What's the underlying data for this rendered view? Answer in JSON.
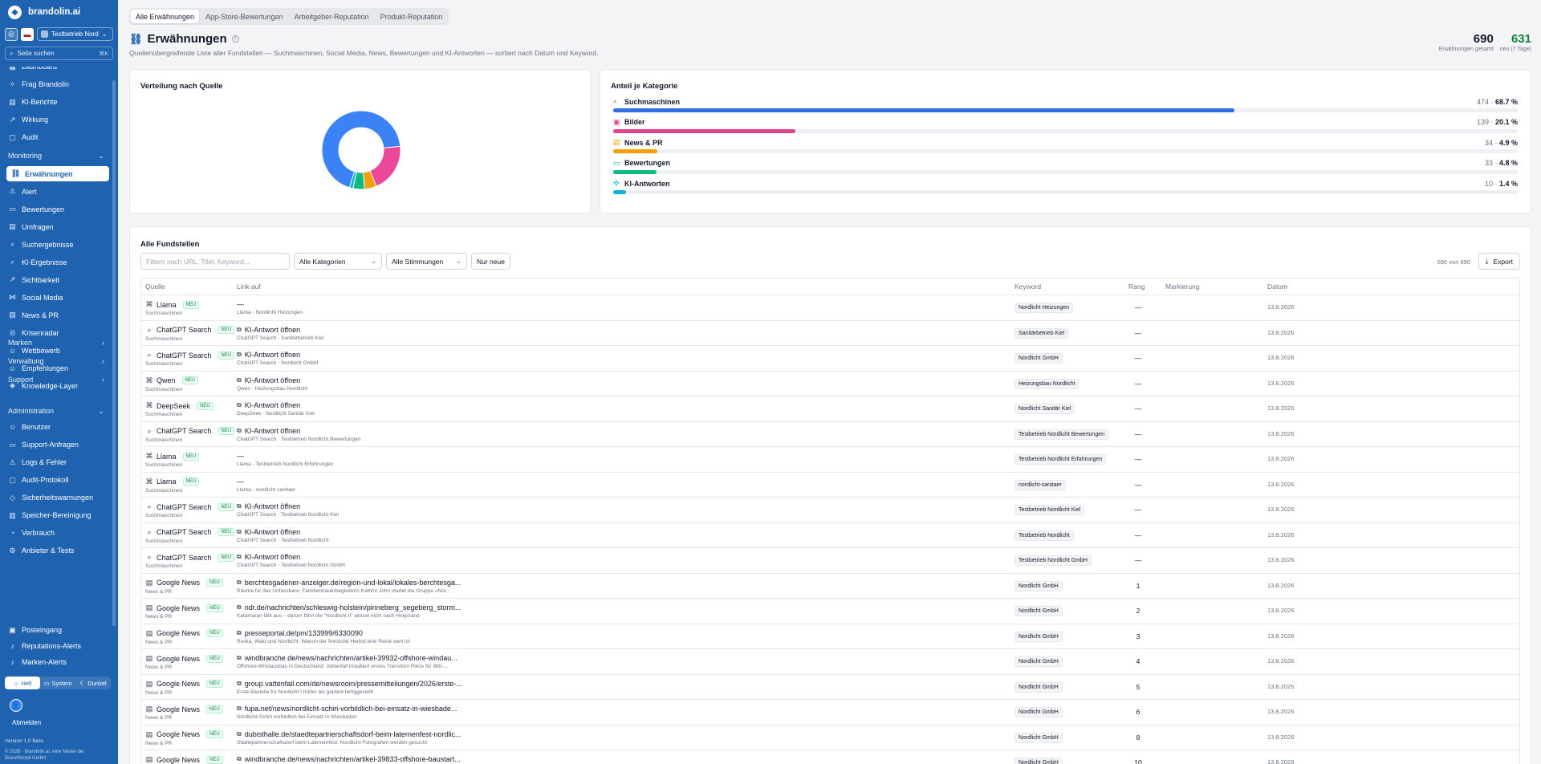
{
  "brand": "brandolin.ai",
  "tenant": "Testbetrieb Nord",
  "sidebar_search": {
    "placeholder": "Seite suchen",
    "shortcut": "⌘K"
  },
  "nav_top": [
    {
      "label": "Dashboard",
      "icon": "grid-icon",
      "y": -9
    },
    {
      "label": "Frag Brandolin",
      "icon": "sparkle-icon",
      "y": 13
    },
    {
      "label": "KI-Berichte",
      "icon": "file-icon",
      "y": 35
    },
    {
      "label": "Wirkung",
      "icon": "trend-icon",
      "y": 57
    },
    {
      "label": "Audit",
      "icon": "doc-icon",
      "y": 79
    }
  ],
  "monitoring_label": "Monitoring",
  "monitoring_items": [
    {
      "label": "Erwähnungen",
      "icon": "link-icon",
      "active": true
    },
    {
      "label": "Alert",
      "icon": "alert-icon"
    },
    {
      "label": "Bewertungen",
      "icon": "chat-icon"
    },
    {
      "label": "Umfragen",
      "icon": "clipboard-icon"
    },
    {
      "label": "Suchergebnisse",
      "icon": "search-icon"
    },
    {
      "label": "KI-Ergebnisse",
      "icon": "search-icon"
    },
    {
      "label": "Sichtbarkeit",
      "icon": "trend-icon"
    },
    {
      "label": "Social Media",
      "icon": "share-icon"
    },
    {
      "label": "News & PR",
      "icon": "news-icon"
    },
    {
      "label": "Krisenradar",
      "icon": "radar-icon"
    },
    {
      "label": "Wettbewerb",
      "icon": "people-icon"
    },
    {
      "label": "Empfehlungen",
      "icon": "people-icon"
    },
    {
      "label": "Knowledge-Layer",
      "icon": "layers-icon"
    }
  ],
  "sections": [
    {
      "label": "Marken",
      "chev": "›"
    },
    {
      "label": "Verwaltung",
      "chev": "›"
    },
    {
      "label": "Support",
      "chev": "›"
    }
  ],
  "admin_label": "Administration",
  "admin_items": [
    {
      "label": "Benutzer",
      "icon": "people-icon"
    },
    {
      "label": "Support-Anfragen",
      "icon": "chat-icon"
    },
    {
      "label": "Logs & Fehler",
      "icon": "alert-icon"
    },
    {
      "label": "Audit-Protokoll",
      "icon": "doc-icon"
    },
    {
      "label": "Sicherheitswarnungen",
      "icon": "shield-icon"
    },
    {
      "label": "Speicher-Bereinigung",
      "icon": "trash-icon"
    },
    {
      "label": "Verbrauch",
      "icon": "gauge-icon"
    },
    {
      "label": "Anbieter & Tests",
      "icon": "gear-icon"
    }
  ],
  "extra_items": [
    {
      "label": "Posteingang",
      "icon": "inbox-icon"
    },
    {
      "label": "Reputations-Alerts",
      "icon": "bell-icon"
    },
    {
      "label": "Marken-Alerts",
      "icon": "bell-icon"
    }
  ],
  "theme": {
    "light": "Hell",
    "system": "System",
    "dark": "Dunkel"
  },
  "logout": "Abmelden",
  "version": "Version 1.0 Beta",
  "copyright": "© 2026 · brandolin.ai, eine Marke der BrandSimpli GmbH",
  "tabs": [
    "Alle Erwähnungen",
    "App-Store-Bewertungen",
    "Arbeitgeber-Reputation",
    "Produkt-Reputation"
  ],
  "page": {
    "title": "Erwähnungen",
    "subtitle": "Quellenübergreifende Liste aller Fundstellen — Suchmaschinen, Social Media, News, Bewertungen und KI-Antworten — sortiert nach Datum und Keyword."
  },
  "stats": [
    {
      "value": "690",
      "label": "Erwähnungen gesamt",
      "green": false
    },
    {
      "value": "631",
      "label": "neu (7 Tage)",
      "green": true
    }
  ],
  "distribution_title": "Verteilung nach Quelle",
  "chart_data": {
    "type": "pie",
    "title": "Verteilung nach Quelle",
    "categories": [
      "Suchmaschinen",
      "Bilder",
      "News & PR",
      "Bewertungen",
      "KI-Antworten"
    ],
    "values": [
      474,
      139,
      34,
      33,
      10
    ],
    "colors": [
      "#3b82f6",
      "#ec4899",
      "#f59e0b",
      "#10b981",
      "#06b6d4"
    ]
  },
  "category_title": "Anteil je Kategorie",
  "categories": [
    {
      "label": "Suchmaschinen",
      "icon": "search-icon",
      "glyph": "⌕",
      "count": "474",
      "pct": "68.7 %",
      "fraction": 0.687,
      "color": "#2f6fe6"
    },
    {
      "label": "Bilder",
      "icon": "image-icon",
      "glyph": "▣",
      "count": "139",
      "pct": "20.1 %",
      "fraction": 0.201,
      "color": "#e0448c"
    },
    {
      "label": "News & PR",
      "icon": "news-icon",
      "glyph": "▤",
      "count": "34",
      "pct": "4.9 %",
      "fraction": 0.049,
      "color": "#f59e0b"
    },
    {
      "label": "Bewertungen",
      "icon": "chat-icon",
      "glyph": "▭",
      "count": "33",
      "pct": "4.8 %",
      "fraction": 0.048,
      "color": "#10b981"
    },
    {
      "label": "KI-Antworten",
      "icon": "sparkle-icon",
      "glyph": "✣",
      "count": "10",
      "pct": "1.4 %",
      "fraction": 0.014,
      "color": "#06b6d4"
    }
  ],
  "table_title": "Alle Fundstellen",
  "filter": {
    "placeholder": "Filtern nach URL, Titel, Keyword...",
    "categories": "Alle Kategorien",
    "moods": "Alle Stimmungen",
    "new_only": "Nur neue"
  },
  "count": "690 von 690",
  "export": "Export",
  "columns": {
    "source": "Quelle",
    "link": "Link auf",
    "keyword": "Keyword",
    "rank": "Rang",
    "mark": "Markierung",
    "date": "Datum"
  },
  "rows": [
    {
      "source": "Llama",
      "icon": "⌘",
      "type": "Suchmaschinen",
      "link": "—",
      "linkicon": "",
      "sub": "Llama · Nordlicht Heizungen",
      "keyword": "Nordlicht Heizungen",
      "rank": "—",
      "date": "13.8.2026"
    },
    {
      "source": "ChatGPT Search",
      "icon": "⌕",
      "type": "Suchmaschinen",
      "link": "KI-Antwort öffnen",
      "linkicon": "↗",
      "sub": "ChatGPT Search · Sanitärbetrieb Kiel",
      "keyword": "Sanitärbetrieb Kiel",
      "rank": "—",
      "date": "13.8.2026"
    },
    {
      "source": "ChatGPT Search",
      "icon": "⌕",
      "type": "Suchmaschinen",
      "link": "KI-Antwort öffnen",
      "linkicon": "↗",
      "sub": "ChatGPT Search · Nordlicht GmbH",
      "keyword": "Nordlicht GmbH",
      "rank": "—",
      "date": "13.8.2026"
    },
    {
      "source": "Qwen",
      "icon": "⌘",
      "type": "Suchmaschinen",
      "link": "KI-Antwort öffnen",
      "linkicon": "↗",
      "sub": "Qwen · Heizungsbau Nordlicht",
      "keyword": "Heizungsbau Nordlicht",
      "rank": "—",
      "date": "13.8.2026"
    },
    {
      "source": "DeepSeek",
      "icon": "⌘",
      "type": "Suchmaschinen",
      "link": "KI-Antwort öffnen",
      "linkicon": "↗",
      "sub": "DeepSeek · Nordlicht Sanitär Kiel",
      "keyword": "Nordlicht Sanitär Kiel",
      "rank": "—",
      "date": "13.8.2026"
    },
    {
      "source": "ChatGPT Search",
      "icon": "⌕",
      "type": "Suchmaschinen",
      "link": "KI-Antwort öffnen",
      "linkicon": "↗",
      "sub": "ChatGPT Search · Testbetrieb Nordlicht Bewertungen",
      "keyword": "Testbetrieb Nordlicht Bewertungen",
      "rank": "—",
      "date": "13.8.2026"
    },
    {
      "source": "Llama",
      "icon": "⌘",
      "type": "Suchmaschinen",
      "link": "—",
      "linkicon": "",
      "sub": "Llama · Testbetrieb Nordlicht Erfahrungen",
      "keyword": "Testbetrieb Nordlicht Erfahrungen",
      "rank": "—",
      "date": "13.8.2026"
    },
    {
      "source": "Llama",
      "icon": "⌘",
      "type": "Suchmaschinen",
      "link": "—",
      "linkicon": "",
      "sub": "Llama · nordlicht-sanitaer",
      "keyword": "nordlicht-sanitaer",
      "rank": "—",
      "date": "13.8.2026"
    },
    {
      "source": "ChatGPT Search",
      "icon": "⌕",
      "type": "Suchmaschinen",
      "link": "KI-Antwort öffnen",
      "linkicon": "↗",
      "sub": "ChatGPT Search · Testbetrieb Nordlicht Kiel",
      "keyword": "Testbetrieb Nordlicht Kiel",
      "rank": "—",
      "date": "13.8.2026"
    },
    {
      "source": "ChatGPT Search",
      "icon": "⌕",
      "type": "Suchmaschinen",
      "link": "KI-Antwort öffnen",
      "linkicon": "↗",
      "sub": "ChatGPT Search · Testbetrieb Nordlicht",
      "keyword": "Testbetrieb Nordlicht",
      "rank": "—",
      "date": "13.8.2026"
    },
    {
      "source": "ChatGPT Search",
      "icon": "⌕",
      "type": "Suchmaschinen",
      "link": "KI-Antwort öffnen",
      "linkicon": "↗",
      "sub": "ChatGPT Search · Testbetrieb Nordlicht GmbH",
      "keyword": "Testbetrieb Nordlicht GmbH",
      "rank": "—",
      "date": "13.8.2026"
    },
    {
      "source": "Google News",
      "icon": "▤",
      "type": "News & PR",
      "link": "berchtesgadener-anzeiger.de/region-und-lokal/lokales-berchtesga...",
      "linkicon": "↗",
      "sub": "Räume für das Unfassbare: Familientrauerbegleiterin Kathrin John startet die Gruppe »Nor...",
      "keyword": "Nordlicht GmbH",
      "rank": "1",
      "date": "13.8.2026"
    },
    {
      "source": "Google News",
      "icon": "▤",
      "type": "News & PR",
      "link": "ndr.de/nachrichten/schleswig-holstein/pinneberg_segeberg_storm...",
      "linkicon": "↗",
      "sub": "Katamaran fällt aus – darum fährt die \"Nordlicht II\" aktuell nicht nach Helgoland",
      "keyword": "Nordlicht GmbH",
      "rank": "2",
      "date": "13.8.2026"
    },
    {
      "source": "Google News",
      "icon": "▤",
      "type": "News & PR",
      "link": "presseportal.de/pm/133999/6330090",
      "linkicon": "↗",
      "sub": "Ruska, Wald und Nordlicht: Warum der finnische Herbst eine Reise wert ist",
      "keyword": "Nordlicht GmbH",
      "rank": "3",
      "date": "13.8.2026"
    },
    {
      "source": "Google News",
      "icon": "▤",
      "type": "News & PR",
      "link": "windbranche.de/news/nachrichten/artikel-39932-offshore-windau...",
      "linkicon": "↗",
      "sub": "Offshore-Windausbau in Deutschland: Vattenfall installiert erstes Transition Piece für 980-...",
      "keyword": "Nordlicht GmbH",
      "rank": "4",
      "date": "13.8.2026"
    },
    {
      "source": "Google News",
      "icon": "▤",
      "type": "News & PR",
      "link": "group.vattenfall.com/de/newsroom/pressemitteilungen/2026/erste-...",
      "linkicon": "↗",
      "sub": "Erste Bauteile für Nordlicht I früher als geplant fertiggestellt",
      "keyword": "Nordlicht GmbH",
      "rank": "5",
      "date": "13.8.2026"
    },
    {
      "source": "Google News",
      "icon": "▤",
      "type": "News & PR",
      "link": "fupa.net/news/nordlicht-schiri-vorbildlich-bei-einsatz-in-wiesbade...",
      "linkicon": "↗",
      "sub": "Nordlicht-Schiri vorbildlich bei Einsatz in Wiesbaden",
      "keyword": "Nordlicht GmbH",
      "rank": "6",
      "date": "13.8.2026"
    },
    {
      "source": "Google News",
      "icon": "▤",
      "type": "News & PR",
      "link": "dubisthalle.de/staedtepartnerschaftsdorf-beim-laternenfest-nordlic...",
      "linkicon": "↗",
      "sub": "Städtepartnerschaftsdorf beim Laternenfest: Nordlicht-Fotografien werden gesucht",
      "keyword": "Nordlicht GmbH",
      "rank": "8",
      "date": "13.8.2026"
    },
    {
      "source": "Google News",
      "icon": "▤",
      "type": "News & PR",
      "link": "windbranche.de/news/nachrichten/artikel-39833-offshore-baustart...",
      "linkicon": "↗",
      "sub": "",
      "keyword": "Nordlicht GmbH",
      "rank": "10",
      "date": "13.8.2026"
    }
  ]
}
